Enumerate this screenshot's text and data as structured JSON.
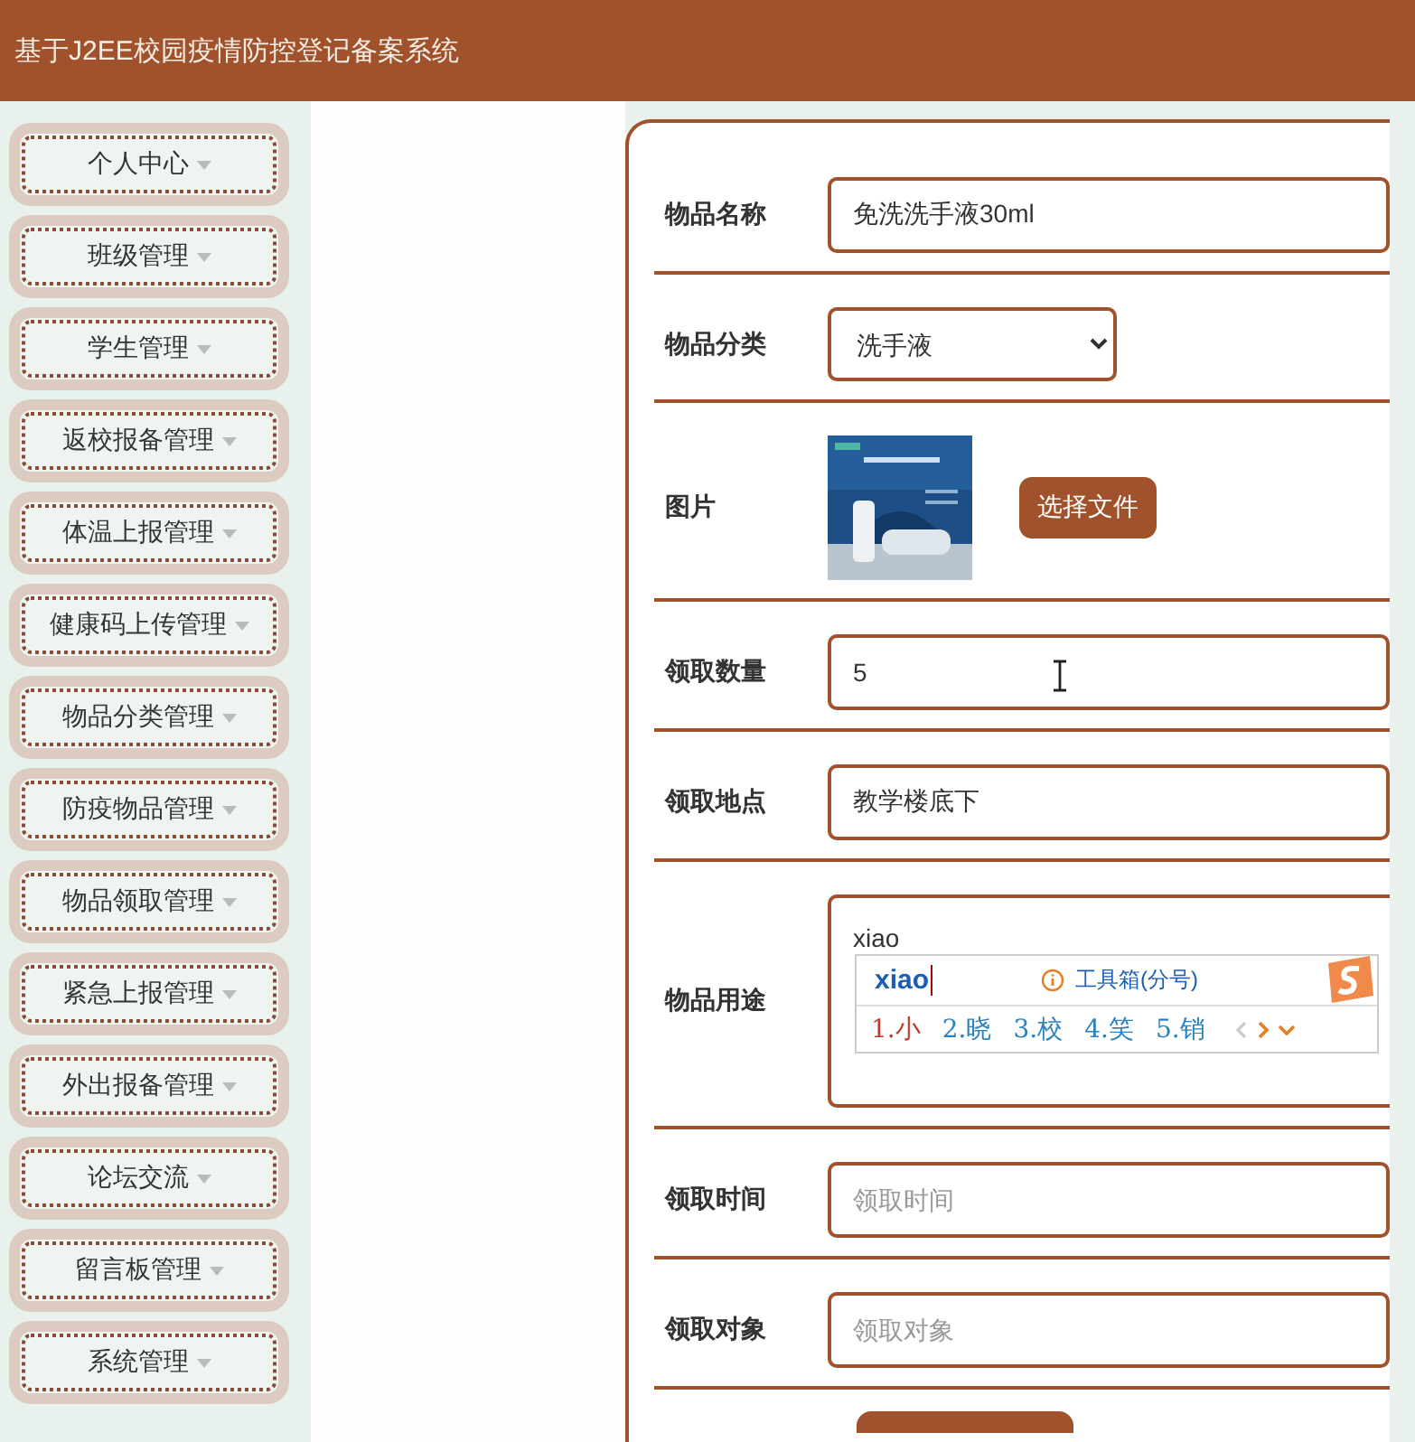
{
  "header": {
    "title": "基于J2EE校园疫情防控登记备案系统"
  },
  "sidebar": {
    "items": [
      {
        "label": "个人中心"
      },
      {
        "label": "班级管理"
      },
      {
        "label": "学生管理"
      },
      {
        "label": "返校报备管理"
      },
      {
        "label": "体温上报管理"
      },
      {
        "label": "健康码上传管理"
      },
      {
        "label": "物品分类管理"
      },
      {
        "label": "防疫物品管理"
      },
      {
        "label": "物品领取管理"
      },
      {
        "label": "紧急上报管理"
      },
      {
        "label": "外出报备管理"
      },
      {
        "label": "论坛交流"
      },
      {
        "label": "留言板管理"
      },
      {
        "label": "系统管理"
      }
    ]
  },
  "form": {
    "fields": [
      {
        "kind": "text",
        "label": "物品名称",
        "value": "免洗洗手液30ml"
      },
      {
        "kind": "select",
        "label": "物品分类",
        "value": "洗手液"
      },
      {
        "label": "图片",
        "button": "选择文件"
      },
      {
        "kind": "text",
        "label": "领取数量",
        "value": "5"
      },
      {
        "kind": "text",
        "label": "领取地点",
        "value": "教学楼底下"
      },
      {
        "kind": "textarea",
        "label": "物品用途",
        "value": "xiao",
        "ime": {
          "composition": "xiao",
          "toolbox": "工具箱(分号)",
          "candidates": [
            {
              "text": "1.小",
              "selected": true
            },
            {
              "text": "2.晓",
              "selected": false
            },
            {
              "text": "3.校",
              "selected": false
            },
            {
              "text": "4.笑",
              "selected": false
            },
            {
              "text": "5.销",
              "selected": false
            }
          ]
        }
      },
      {
        "kind": "text",
        "label": "领取时间",
        "placeholder": "领取时间"
      },
      {
        "kind": "text",
        "label": "领取对象",
        "placeholder": "领取对象"
      }
    ]
  }
}
